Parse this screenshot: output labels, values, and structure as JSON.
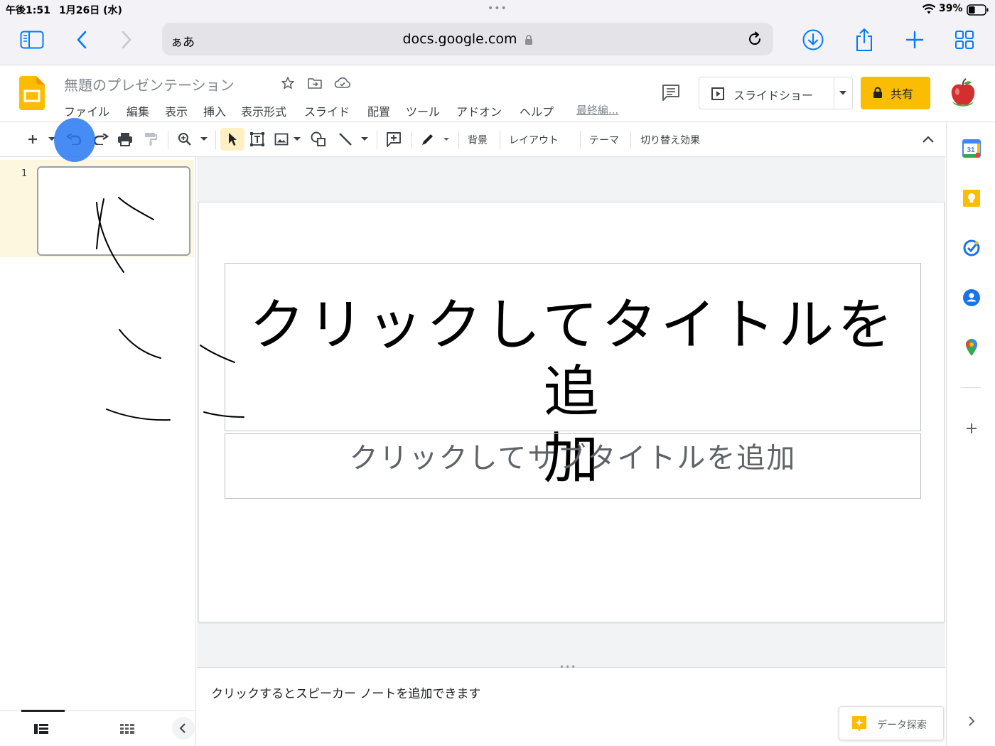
{
  "status_bar": {
    "time": "午後1:51",
    "date": "1月26日 (水)",
    "dots": "•••",
    "battery_percent": "39%",
    "battery_level": 0.39
  },
  "safari": {
    "reader_label": "ぁあ",
    "url_host": "docs.google.com",
    "icons": [
      "sidebar-icon",
      "back-icon",
      "forward-icon",
      "lock-icon",
      "reload-icon",
      "download-icon",
      "share-icon",
      "new-tab-icon",
      "tabs-overview-icon"
    ],
    "accent_color": "#007aff"
  },
  "slides_header": {
    "doc_title": "無題のプレゼンテーション",
    "menu": [
      "ファイル",
      "編集",
      "表示",
      "挿入",
      "表示形式",
      "スライド",
      "配置",
      "ツール",
      "アドオン",
      "ヘルプ"
    ],
    "last_edit": "最終編...",
    "slideshow_label": "スライドショー",
    "share_label": "共有",
    "share_color": "#fbbc04"
  },
  "toolbar": {
    "background_label": "背景",
    "layout_label": "レイアウト",
    "theme_label": "テーマ",
    "transition_label": "切り替え効果"
  },
  "filmstrip": {
    "slide_number": "1"
  },
  "slide": {
    "title_line1": "クリックしてタイトルを追",
    "title_line2": "加",
    "subtitle": "クリックしてサブタイトルを追加"
  },
  "notes": {
    "dots": "•••",
    "placeholder": "クリックするとスピーカー ノートを追加できます",
    "explore_label": "データ探索"
  },
  "side_panel": {
    "calendar_day": "31",
    "icons": [
      "calendar-icon",
      "keep-icon",
      "tasks-icon",
      "contacts-icon",
      "maps-icon",
      "add-addon-icon",
      "expand-panel-icon"
    ]
  }
}
